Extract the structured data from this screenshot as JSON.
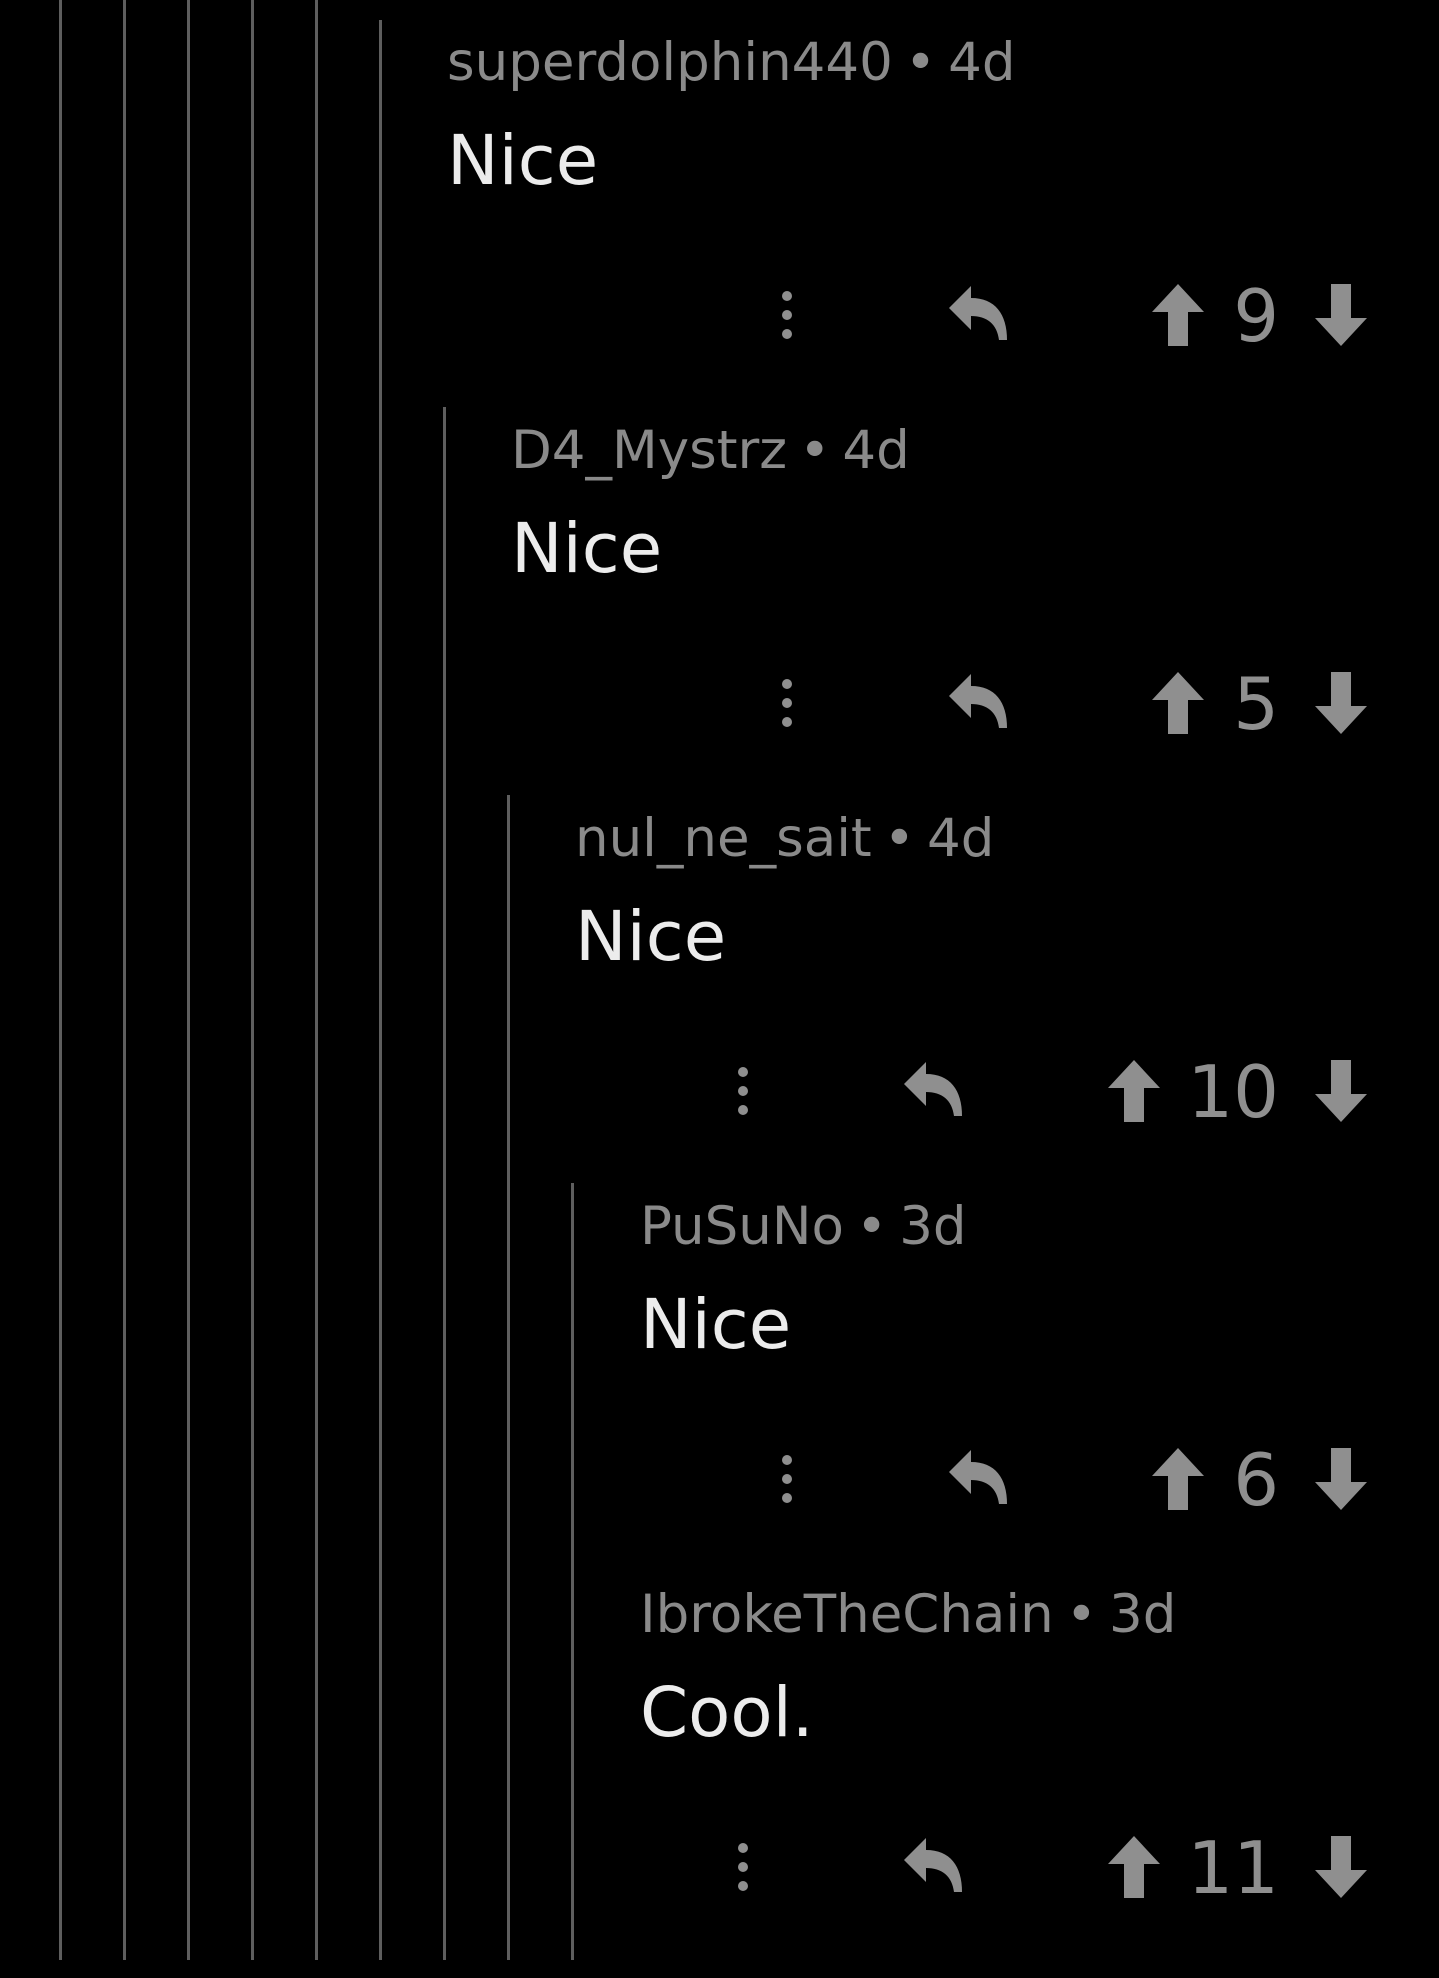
{
  "colors": {
    "background": "#000000",
    "thread_line": "#5e5e5e",
    "meta_text": "#8a8a8a",
    "body_text": "#ececec",
    "action_icon": "#8f8f8f"
  },
  "comments": [
    {
      "author": "superdolphin440",
      "separator": "•",
      "age": "4d",
      "text": "Nice",
      "score": "9",
      "icons": [
        "more-vertical-icon",
        "reply-icon",
        "upvote-arrow-icon",
        "downvote-arrow-icon"
      ]
    },
    {
      "author": "D4_Mystrz",
      "separator": "•",
      "age": "4d",
      "text": "Nice",
      "score": "5",
      "icons": [
        "more-vertical-icon",
        "reply-icon",
        "upvote-arrow-icon",
        "downvote-arrow-icon"
      ]
    },
    {
      "author": "nul_ne_sait",
      "separator": "•",
      "age": "4d",
      "text": "Nice",
      "score": "10",
      "icons": [
        "more-vertical-icon",
        "reply-icon",
        "upvote-arrow-icon",
        "downvote-arrow-icon"
      ]
    },
    {
      "author": "PuSuNo",
      "separator": "•",
      "age": "3d",
      "text": "Nice",
      "score": "6",
      "icons": [
        "more-vertical-icon",
        "reply-icon",
        "upvote-arrow-icon",
        "downvote-arrow-icon"
      ]
    },
    {
      "author": "IbrokeTheChain",
      "separator": "•",
      "age": "3d",
      "text": "Cool.",
      "score": "11",
      "icons": [
        "more-vertical-icon",
        "reply-icon",
        "upvote-arrow-icon",
        "downvote-arrow-icon"
      ]
    }
  ]
}
